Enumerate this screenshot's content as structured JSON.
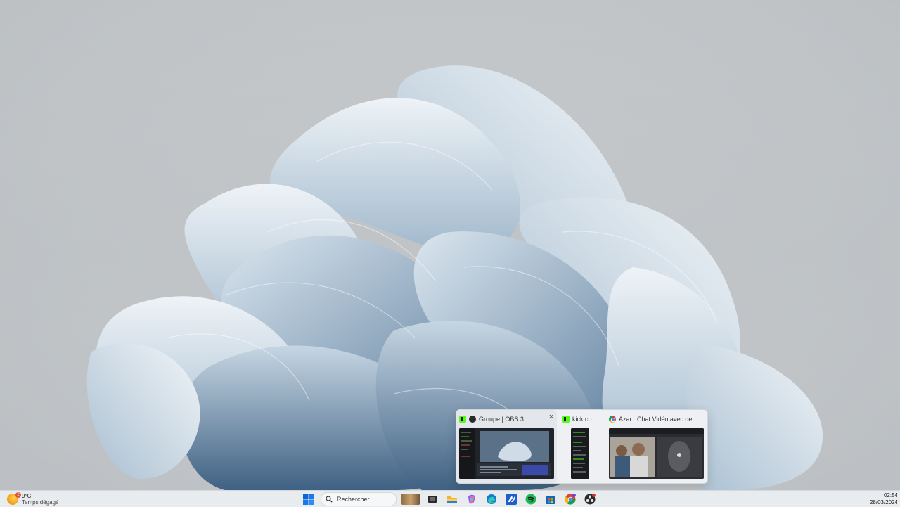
{
  "weather": {
    "temp": "9°C",
    "condition": "Temps dégagé",
    "badge": "2"
  },
  "search": {
    "label": "Rechercher"
  },
  "clock": {
    "time": "02:54",
    "date": "28/03/2024"
  },
  "preview": {
    "cards": [
      {
        "title": "Groupe | OBS 3...",
        "app_icon": "kick-icon",
        "tab_icon": "obs-icon",
        "close_label": "×"
      },
      {
        "title": "kick.co...",
        "app_icon": "kick-icon"
      },
      {
        "title": "Azar : Chat Vidéo avec de...",
        "app_icon": "chrome-icon"
      }
    ]
  },
  "taskbar": {
    "apps": [
      "start-icon",
      "search-icon",
      "task-view-icon",
      "file-explorer-icon",
      "copilot-icon",
      "edge-icon",
      "app-icon",
      "spotify-icon",
      "store-icon",
      "chrome-icon",
      "obs-icon"
    ]
  },
  "colors": {
    "accent": "#0a64d6",
    "kick_green": "#53fc18",
    "spotify": "#1db954"
  }
}
